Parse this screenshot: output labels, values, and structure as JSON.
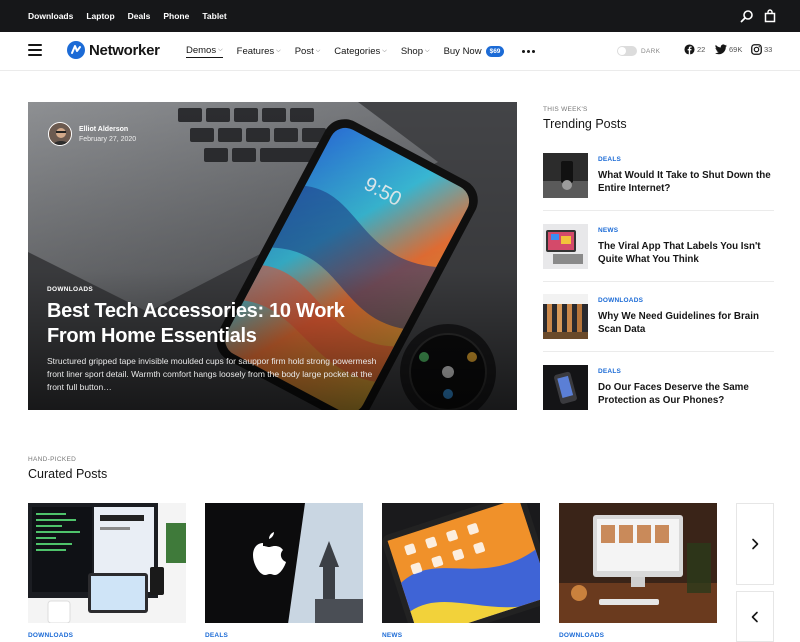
{
  "topbar": {
    "links": [
      "Downloads",
      "Laptop",
      "Deals",
      "Phone",
      "Tablet"
    ],
    "icons": [
      "search-icon",
      "bag-icon"
    ]
  },
  "header": {
    "logo": "Networker",
    "nav": [
      {
        "label": "Demos",
        "has_dropdown": true,
        "active": true
      },
      {
        "label": "Features",
        "has_dropdown": true
      },
      {
        "label": "Post",
        "has_dropdown": true
      },
      {
        "label": "Categories",
        "has_dropdown": true
      },
      {
        "label": "Shop",
        "has_dropdown": true
      },
      {
        "label": "Buy Now",
        "badge": "$69"
      }
    ],
    "dark_label": "DARK",
    "social": [
      {
        "icon": "facebook-icon",
        "count": "22"
      },
      {
        "icon": "twitter-icon",
        "count": "69K"
      },
      {
        "icon": "instagram-icon",
        "count": "33"
      }
    ]
  },
  "hero": {
    "author": "Elliot Alderson",
    "date": "February 27, 2020",
    "category": "DOWNLOADS",
    "title": "Best Tech Accessories: 10 Work From Home Essentials",
    "excerpt": "Structured gripped tape invisible moulded cups for sauppor firm hold strong powermesh front liner sport detail. Warmth comfort hangs loosely from the body large pocket at the front full button…"
  },
  "trending": {
    "kicker": "THIS WEEK'S",
    "title": "Trending Posts",
    "items": [
      {
        "category": "DEALS",
        "title": "What Would It Take to Shut Down the Entire Internet?"
      },
      {
        "category": "NEWS",
        "title": "The Viral App That Labels You Isn't Quite What You Think"
      },
      {
        "category": "DOWNLOADS",
        "title": "Why We Need Guidelines for Brain Scan Data"
      },
      {
        "category": "DEALS",
        "title": "Do Our Faces Deserve the Same Protection as Our Phones?"
      }
    ]
  },
  "curated": {
    "kicker": "HAND-PICKED",
    "title": "Curated Posts",
    "cards": [
      {
        "category": "DOWNLOADS"
      },
      {
        "category": "DEALS"
      },
      {
        "category": "NEWS"
      },
      {
        "category": "DOWNLOADS"
      }
    ]
  },
  "colors": {
    "accent": "#1c6bd6",
    "topbar": "#161719"
  }
}
